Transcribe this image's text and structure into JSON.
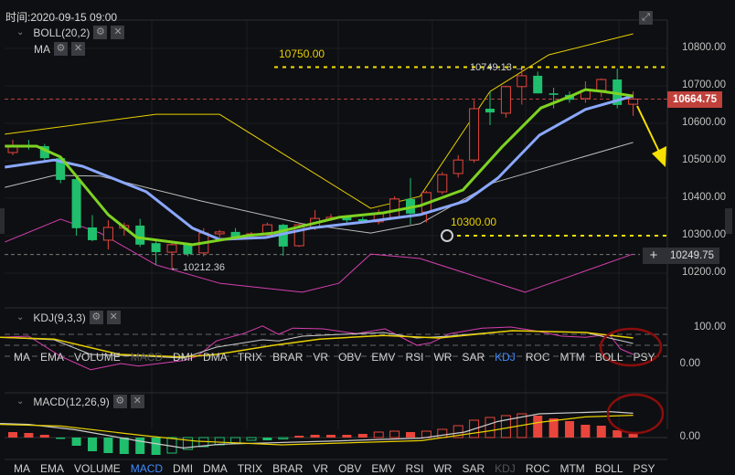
{
  "header": {
    "time_label": "时间:2020-09-15 09:00",
    "boll_label": "BOLL(20,2)",
    "ma_label": "MA"
  },
  "price_axis": {
    "ticks": [
      "10800.00",
      "10700.00",
      "10600.00",
      "10500.00",
      "10400.00",
      "10300.00",
      "10200.00"
    ],
    "tick_values": [
      10800,
      10700,
      10600,
      10500,
      10400,
      10300,
      10200
    ],
    "current_price": "10664.75",
    "current_price_value": 10664.75,
    "crosshair_price": "10249.75",
    "crosshair_value": 10249.75
  },
  "annotations": {
    "line_10750": "10750.00",
    "line_10750_value": 10750,
    "high_label": "10749.13 →",
    "low_label": "← 10212.36",
    "line_10300": "10300.00",
    "line_10300_value": 10300
  },
  "kdj": {
    "label": "KDJ(9,3,3)",
    "ticks": [
      "100.00",
      "0.00"
    ]
  },
  "macd": {
    "label": "MACD(12,26,9)",
    "ticks": [
      "0.00"
    ]
  },
  "indicator_tabs": [
    "MA",
    "EMA",
    "VOLUME",
    "MACD",
    "DMI",
    "DMA",
    "TRIX",
    "BRAR",
    "VR",
    "OBV",
    "EMV",
    "RSI",
    "WR",
    "SAR",
    "KDJ",
    "ROC",
    "MTM",
    "BOLL",
    "PSY"
  ],
  "kdj_tabs_active": "KDJ",
  "kdj_tabs_dim": "MACD",
  "macd_tabs_active": "MACD",
  "macd_tabs_dim": "KDJ",
  "colors": {
    "up": "#e8453c",
    "down": "#1fbf6e",
    "ma_green": "#7ed321",
    "ma_blue": "#8aa8ff",
    "boll_upper": "#e8d000",
    "boll_mid": "#bbbbbb",
    "boll_lower": "#d63fb0",
    "annotation_yellow": "#f5e000",
    "circle": "#8b0d0d",
    "badge": "#c0413b"
  },
  "icons": [
    "chevron-down-icon",
    "gear-icon",
    "close-icon",
    "expand-icon",
    "plus-icon",
    "arrow-icon"
  ],
  "chart_data": {
    "type": "candlestick",
    "candles": [
      [
        10522,
        10556,
        10515,
        10539
      ],
      [
        10541,
        10556,
        10530,
        10537
      ],
      [
        10539,
        10545,
        10500,
        10507
      ],
      [
        10507,
        10510,
        10440,
        10449
      ],
      [
        10451,
        10460,
        10300,
        10320
      ],
      [
        10322,
        10355,
        10285,
        10288
      ],
      [
        10288,
        10341,
        10263,
        10322
      ],
      [
        10320,
        10335,
        10300,
        10327
      ],
      [
        10327,
        10345,
        10270,
        10276
      ],
      [
        10280,
        10285,
        10222,
        10256
      ],
      [
        10256,
        10285,
        10212.36,
        10276
      ],
      [
        10276,
        10280,
        10245,
        10251
      ],
      [
        10254,
        10320,
        10245,
        10307
      ],
      [
        10305,
        10315,
        10295,
        10310
      ],
      [
        10310,
        10320,
        10288,
        10290
      ],
      [
        10300,
        10310,
        10290,
        10305
      ],
      [
        10302,
        10335,
        10295,
        10329
      ],
      [
        10329,
        10332,
        10246,
        10271
      ],
      [
        10273,
        10335,
        10270,
        10329
      ],
      [
        10322,
        10368,
        10315,
        10346
      ],
      [
        10344,
        10358,
        10340,
        10349
      ],
      [
        10349,
        10355,
        10335,
        10341
      ],
      [
        10344,
        10350,
        10335,
        10339
      ],
      [
        10337,
        10370,
        10330,
        10359
      ],
      [
        10349,
        10405,
        10345,
        10398
      ],
      [
        10398,
        10454,
        10330,
        10359
      ],
      [
        10363,
        10420,
        10335,
        10415
      ],
      [
        10417,
        10470,
        10410,
        10463
      ],
      [
        10466,
        10515,
        10455,
        10502
      ],
      [
        10502,
        10662,
        10495,
        10639
      ],
      [
        10639,
        10685,
        10595,
        10629
      ],
      [
        10627,
        10700,
        10615,
        10698
      ],
      [
        10698,
        10749.13,
        10650,
        10727
      ],
      [
        10727,
        10738,
        10680,
        10680
      ],
      [
        10680,
        10695,
        10640,
        10676
      ],
      [
        10676,
        10685,
        10655,
        10663
      ],
      [
        10666,
        10712,
        10655,
        10688
      ],
      [
        10688,
        10720,
        10670,
        10717
      ],
      [
        10717,
        10746,
        10640,
        10649
      ],
      [
        10651,
        10685,
        10620,
        10664.75
      ]
    ],
    "boll_upper": [
      [
        -0.5,
        10571
      ],
      [
        9,
        10624
      ],
      [
        13,
        10624
      ],
      [
        22.5,
        10373
      ],
      [
        25.6,
        10405
      ],
      [
        30,
        10685
      ],
      [
        33.7,
        10783
      ],
      [
        39,
        10839
      ]
    ],
    "boll_mid": [
      [
        -0.5,
        10429
      ],
      [
        2.6,
        10461
      ],
      [
        5.5,
        10459
      ],
      [
        11.8,
        10393
      ],
      [
        18.2,
        10332
      ],
      [
        22.5,
        10307
      ],
      [
        25.6,
        10332
      ],
      [
        30.2,
        10441
      ],
      [
        39,
        10549
      ]
    ],
    "boll_lower": [
      [
        -0.5,
        10283
      ],
      [
        3,
        10344
      ],
      [
        5.5,
        10307
      ],
      [
        9,
        10222
      ],
      [
        13,
        10173
      ],
      [
        18.2,
        10149
      ],
      [
        20.5,
        10173
      ],
      [
        22.5,
        10251
      ],
      [
        25.6,
        10239
      ],
      [
        32.2,
        10149
      ],
      [
        39,
        10251
      ]
    ],
    "ma_green": [
      [
        -0.5,
        10539
      ],
      [
        1.5,
        10539
      ],
      [
        3,
        10510
      ],
      [
        6,
        10356
      ],
      [
        7.8,
        10295
      ],
      [
        11.3,
        10276
      ],
      [
        14.7,
        10300
      ],
      [
        16.4,
        10307
      ],
      [
        20.5,
        10349
      ],
      [
        23.3,
        10361
      ],
      [
        25.6,
        10380
      ],
      [
        28.3,
        10422
      ],
      [
        30.8,
        10539
      ],
      [
        33.2,
        10641
      ],
      [
        35.1,
        10673
      ],
      [
        36,
        10690
      ],
      [
        37.1,
        10685
      ],
      [
        39,
        10673
      ]
    ],
    "ma_blue": [
      [
        -0.5,
        10483
      ],
      [
        2.6,
        10502
      ],
      [
        4.4,
        10485
      ],
      [
        8.4,
        10417
      ],
      [
        11.3,
        10320
      ],
      [
        13,
        10290
      ],
      [
        15.9,
        10295
      ],
      [
        18.7,
        10320
      ],
      [
        22.2,
        10337
      ],
      [
        25.6,
        10356
      ],
      [
        28.5,
        10393
      ],
      [
        30.5,
        10454
      ],
      [
        33.1,
        10568
      ],
      [
        36,
        10637
      ],
      [
        39,
        10673
      ]
    ],
    "kdj_k": [
      [
        -0.8,
        72
      ],
      [
        2.6,
        65
      ],
      [
        4.9,
        25
      ],
      [
        8.4,
        20
      ],
      [
        10.7,
        15
      ],
      [
        12.8,
        45
      ],
      [
        15.7,
        65
      ],
      [
        16.7,
        62
      ],
      [
        18.2,
        75
      ],
      [
        23.3,
        85
      ],
      [
        25.4,
        70
      ],
      [
        27.4,
        75
      ],
      [
        31.4,
        90
      ],
      [
        36,
        85
      ],
      [
        39,
        55
      ]
    ],
    "kdj_d": [
      [
        -0.8,
        72
      ],
      [
        2.6,
        67
      ],
      [
        6.7,
        25
      ],
      [
        10.7,
        18
      ],
      [
        12.8,
        25
      ],
      [
        16.4,
        50
      ],
      [
        19.3,
        67
      ],
      [
        23.3,
        77
      ],
      [
        26.8,
        70
      ],
      [
        31.4,
        90
      ],
      [
        36,
        85
      ],
      [
        39,
        70
      ]
    ],
    "kdj_j": [
      [
        -0.8,
        72
      ],
      [
        1,
        75
      ],
      [
        3,
        20
      ],
      [
        4.9,
        -17
      ],
      [
        6.8,
        0
      ],
      [
        7.9,
        -7
      ],
      [
        10.7,
        8
      ],
      [
        11.6,
        20
      ],
      [
        12.8,
        62
      ],
      [
        14.5,
        82
      ],
      [
        15.7,
        103
      ],
      [
        16.7,
        80
      ],
      [
        17.6,
        97
      ],
      [
        19.5,
        95
      ],
      [
        21.6,
        82
      ],
      [
        23.4,
        95
      ],
      [
        25.4,
        50
      ],
      [
        26.3,
        57
      ],
      [
        27.5,
        82
      ],
      [
        29.5,
        97
      ],
      [
        31.3,
        100
      ],
      [
        32.8,
        90
      ],
      [
        34.5,
        75
      ],
      [
        36,
        72
      ],
      [
        37.5,
        80
      ],
      [
        38.2,
        40
      ],
      [
        39,
        25
      ]
    ],
    "kdj_levels": [
      80,
      50,
      20
    ],
    "macd_hist": [
      12,
      10,
      6,
      -2,
      -18,
      -30,
      -34,
      -36,
      -36,
      -38,
      -34,
      -26,
      -20,
      -16,
      -12,
      -6,
      -6,
      -2,
      4,
      6,
      6,
      6,
      8,
      12,
      14,
      12,
      14,
      18,
      26,
      38,
      44,
      48,
      52,
      48,
      42,
      36,
      28,
      26,
      16,
      8
    ],
    "macd_dif": [
      [
        -0.8,
        30.7
      ],
      [
        1,
        28.7
      ],
      [
        3.9,
        17.3
      ],
      [
        8,
        -8
      ],
      [
        10.7,
        -22.7
      ],
      [
        13,
        -14.7
      ],
      [
        19.8,
        -8
      ],
      [
        25.7,
        -1.3
      ],
      [
        28.4,
        12
      ],
      [
        30.5,
        35.3
      ],
      [
        33.1,
        52
      ],
      [
        37.5,
        56.7
      ],
      [
        39,
        53.3
      ]
    ],
    "macd_dea": [
      [
        -0.8,
        28.7
      ],
      [
        3,
        25.3
      ],
      [
        8,
        5.3
      ],
      [
        11.6,
        -8
      ],
      [
        16.9,
        -16
      ],
      [
        25.7,
        -6.7
      ],
      [
        30.1,
        15.3
      ],
      [
        33.1,
        33.3
      ],
      [
        36,
        45.3
      ],
      [
        39,
        48.7
      ]
    ]
  }
}
